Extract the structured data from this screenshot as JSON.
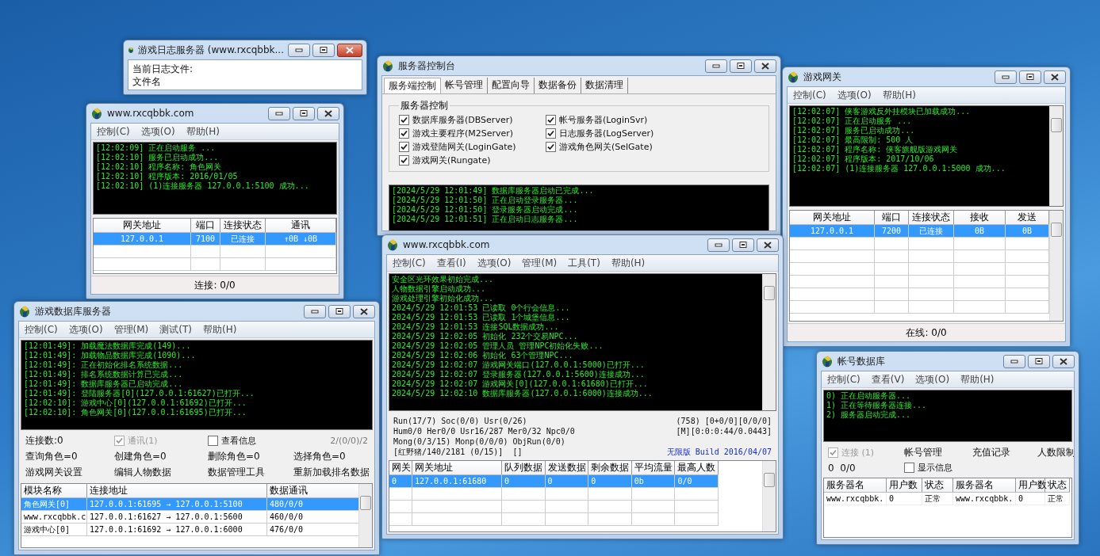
{
  "windows": [
    {
      "title": "游戏日志服务器 (www.rxcqbbk...",
      "active": true,
      "sections": [
        {
          "kind": "text",
          "lines": [
            "当前日志文件:",
            "文件名"
          ]
        }
      ]
    },
    {
      "title": "服务器控制台",
      "active": false,
      "sections": [
        {
          "kind": "tabs",
          "tabs": [
            {
              "label": "服务端控制",
              "selected": true
            },
            {
              "label": "帐号管理",
              "selected": false
            },
            {
              "label": "配置向导",
              "selected": false
            },
            {
              "label": "数据备份",
              "selected": false
            },
            {
              "label": "数据清理",
              "selected": false
            }
          ]
        },
        {
          "kind": "checkgroup",
          "title": "服务器控制",
          "items": [
            {
              "label": "数据库服务器(DBServer)",
              "checked": true
            },
            {
              "label": "帐号服务器(LoginSvr)",
              "checked": true
            },
            {
              "label": "游戏主要程序(M2Server)",
              "checked": true
            },
            {
              "label": "日志服务器(LogServer)",
              "checked": true
            },
            {
              "label": "游戏登陆网关(LoginGate)",
              "checked": true
            },
            {
              "label": "游戏角色网关(SelGate)",
              "checked": true
            },
            {
              "label": "游戏网关(Rungate)",
              "checked": true
            }
          ]
        },
        {
          "kind": "log",
          "scrollbar": false,
          "lines": [
            "[2024/5/29 12:01:49] 数据库服务器启动已完成...",
            "[2024/5/29 12:01:50] 正在启动登录服务器...",
            "[2024/5/29 12:01:50] 登录服务器启动完成...",
            "[2024/5/29 12:01:51] 正在启动日志服务器..."
          ]
        }
      ]
    },
    {
      "title": "www.rxcqbbk.com",
      "active": false,
      "menu": [
        "控制(C)",
        "选项(O)",
        "帮助(H)"
      ],
      "sections": [
        {
          "kind": "log",
          "scrollbar": false,
          "lines": [
            "[12:02:09] 正在启动服务 ...",
            "[12:02:10] 服务已启动成功...",
            "[12:02:10] 程序名称: 角色网关",
            "[12:02:10] 程序版本: 2016/01/05",
            "[12:02:10] (1)连接服务器 127.0.0.1:5100 成功..."
          ]
        },
        {
          "kind": "listview",
          "scrollbar": false,
          "columns": [
            "网关地址",
            "端口",
            "连接状态",
            "通讯"
          ],
          "rows": [
            {
              "cells": [
                "127.0.0.1",
                "7100",
                "已连接",
                "↑0B  ↓0B"
              ],
              "selected": true
            }
          ]
        },
        {
          "kind": "statusbar",
          "text": "连接: 0/0"
        }
      ]
    },
    {
      "title": "游戏网关",
      "active": false,
      "menu": [
        "控制(C)",
        "选项(O)",
        "帮助(H)"
      ],
      "sections": [
        {
          "kind": "log",
          "scrollbar": true,
          "lines": [
            "[12:02:07] 侠客游戏反外挂模块已加载成功...",
            "[12:02:07] 正在启动服务 ...",
            "[12:02:07] 服务已启动成功...",
            "[12:02:07] 最高限制: 500 人",
            "[12:02:07] 程序名称: 侠客旗舰版游戏网关",
            "[12:02:07] 程序版本: 2017/10/06",
            "[12:02:07] (1)连接服务器 127.0.0.1:5000 成功..."
          ]
        },
        {
          "kind": "listview",
          "scrollbar": true,
          "columns": [
            "网关地址",
            "端口",
            "连接状态",
            "接收",
            "发送"
          ],
          "rows": [
            {
              "cells": [
                "127.0.0.1",
                "7200",
                "已连接",
                "0B",
                "0B"
              ],
              "selected": true
            }
          ]
        },
        {
          "kind": "statusbar",
          "text": "在线: 0/0"
        }
      ]
    },
    {
      "title": "游戏数据库服务器",
      "active": false,
      "menu": [
        "控制(C)",
        "选项(O)",
        "管理(M)",
        "测试(T)",
        "帮助(H)"
      ],
      "sections": [
        {
          "kind": "log",
          "scrollbar": false,
          "lines": [
            "[12:01:49]: 加载魔法数据库完成(149)...",
            "[12:01:49]: 加载物品数据库完成(1090)...",
            "[12:01:49]: 正在初始化排名系统数据...",
            "[12:01:49]: 排名系统数据计算已完成...",
            "[12:01:49]: 数据库服务器已启动完成...",
            "[12:01:49]: 登陆服务器[0](127.0.0.1:61627)已打开...",
            "[12:02:10]: 游戏中心[0](127.0.0.1:61692)已打开...",
            "[12:02:10]: 角色网关[0](127.0.0.1:61695)已打开..."
          ]
        },
        {
          "kind": "panel",
          "rows": [
            [
              {
                "kind": "text",
                "label": "连接数:0"
              },
              {
                "kind": "check",
                "label": "通讯(1)",
                "checked": true,
                "disabled": true
              },
              {
                "kind": "check",
                "label": "查看信息",
                "checked": false,
                "disabled": false
              },
              {
                "kind": "text",
                "label": "2/(0/0)/2"
              }
            ],
            [
              {
                "kind": "text",
                "label": "查询角色=0"
              },
              {
                "kind": "text",
                "label": "创建角色=0"
              },
              {
                "kind": "text",
                "label": "删除角色=0"
              },
              {
                "kind": "text",
                "label": "选择角色=0"
              }
            ],
            [
              {
                "kind": "action",
                "label": "游戏网关设置"
              },
              {
                "kind": "action",
                "label": "编辑人物数据"
              },
              {
                "kind": "action",
                "label": "数据管理工具"
              },
              {
                "kind": "action",
                "label": "重新加载排名数据"
              }
            ]
          ]
        },
        {
          "kind": "grid",
          "scrollbar": true,
          "columns": [
            "模块名称",
            "连接地址",
            "数据通讯"
          ],
          "rows": [
            {
              "cells": [
                "角色网关[0]",
                "127.0.0.1:61695 → 127.0.0.1:5100",
                "480/0/0"
              ],
              "selected": true
            },
            {
              "cells": [
                "www.rxcqbbk.c",
                "127.0.0.1:61627 → 127.0.0.1:5600",
                "460/0/0"
              ],
              "selected": false
            },
            {
              "cells": [
                "游戏中心[0]",
                "127.0.0.1:61692 → 127.0.0.1:6000",
                "476/0/0"
              ],
              "selected": false
            }
          ]
        }
      ]
    },
    {
      "title": "www.rxcqbbk.com",
      "active": false,
      "menu": [
        "控制(C)",
        "查看(I)",
        "选项(O)",
        "管理(M)",
        "工具(T)",
        "帮助(H)"
      ],
      "sections": [
        {
          "kind": "log",
          "scrollbar": true,
          "lines": [
            "安全区光环效果初始完成...",
            "人物数据引擎启动成功...",
            "游戏处理引擎初始化成功...",
            "2024/5/29 12:01:53 已读取 0个行会信息...",
            "2024/5/29 12:01:53 已读取 1个城堡信息...",
            "2024/5/29 12:01:53 连接SQL数据成功...",
            "2024/5/29 12:02:05 初始化 232个交易NPC...",
            "2024/5/29 12:02:05 管理人员 管理NPC初始化失败...",
            "2024/5/29 12:02:06 初始化 63个管理NPC...",
            "2024/5/29 12:02:07 游戏网关端口(127.0.0.1:5000)已打开...",
            "2024/5/29 12:02:07 登录服务器(127.0.0.1:5600)连接成功...",
            "2024/5/29 12:02:07 游戏网关[0](127.0.0.1:61680)已打开...",
            "2024/5/29 12:02:10 数据库服务器(127.0.0.1:6000)连接成功..."
          ]
        },
        {
          "kind": "info",
          "left": [
            "Run(17/7) Soc(0/0) Usr(0/26)",
            "Hum0/0 Her0/0 Usr16/287 Mer0/32 Npc0/0",
            "Mong(0/3/15) Monp(0/0/0) ObjRun(0/0)",
            "[红野猪/140/2181 (0/15)]  []"
          ],
          "right": [
            {
              "kind": "plain",
              "text": "(758) [0+0/0][0/0/0]"
            },
            {
              "kind": "plain",
              "text": "[M][0:0:0:44/0.0443]"
            },
            {
              "kind": "build",
              "text": "无限版 Build 2016/04/07"
            }
          ]
        },
        {
          "kind": "grid",
          "scrollbar": true,
          "columns": [
            "网关",
            "网关地址",
            "队列数据",
            "发送数据",
            "剩余数据",
            "平均流量",
            "最高人数"
          ],
          "rows": [
            {
              "cells": [
                "0",
                "127.0.0.1:61680",
                "0",
                "0",
                "0",
                "0b",
                "0/0"
              ],
              "selected": true
            }
          ]
        }
      ]
    },
    {
      "title": "帐号数据库",
      "active": false,
      "menu": [
        "控制(C)",
        "查看(V)",
        "选项(O)",
        "帮助(H)"
      ],
      "sections": [
        {
          "kind": "log",
          "scrollbar": false,
          "lines": [
            "0) 正在启动服务器...",
            "1) 正在等待服务器连接...",
            "2) 服务器启动完成..."
          ]
        },
        {
          "kind": "panel",
          "rows": [
            [
              {
                "kind": "check",
                "label": "连接 (1)",
                "checked": true,
                "disabled": true
              },
              {
                "kind": "action",
                "label": "帐号管理"
              },
              {
                "kind": "action",
                "label": "充值记录"
              },
              {
                "kind": "action",
                "label": "人数限制"
              }
            ],
            [
              {
                "kind": "text",
                "label": "0  0/0"
              },
              {
                "kind": "check",
                "label": "显示信息",
                "checked": false,
                "disabled": false
              }
            ]
          ]
        },
        {
          "kind": "table",
          "scrollbar": false,
          "columns": [
            "服务器名",
            "用户数",
            "状态",
            "服务器名",
            "用户数",
            "状态"
          ],
          "rows": [
            {
              "cells": [
                "www.rxcqbbk.",
                "0",
                "正常",
                "www.rxcqbbk.",
                "0",
                "正常"
              ],
              "selected": false
            }
          ]
        }
      ]
    }
  ]
}
